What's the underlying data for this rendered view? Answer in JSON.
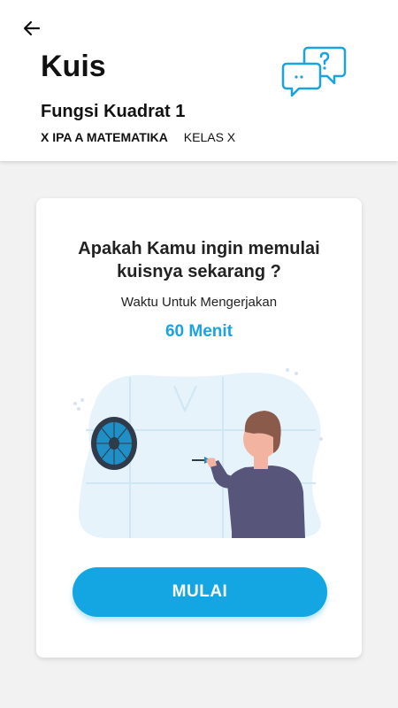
{
  "header": {
    "title": "Kuis",
    "quiz_name": "Fungsi Kuadrat 1",
    "subject": "X IPA A MATEMATIKA",
    "class_label": "KELAS X",
    "back_icon": "arrow-left-icon",
    "chat_icon": "chat-question-icon"
  },
  "card": {
    "question_line1": "Apakah Kamu ingin memulai",
    "question_line2": "kuisnya sekarang ?",
    "time_label": "Waktu Untuk Mengerjakan",
    "time_value": "60 Menit",
    "start_button": "MULAI"
  },
  "colors": {
    "accent": "#14a6e3",
    "text": "#111111",
    "background": "#f2f2f2"
  }
}
